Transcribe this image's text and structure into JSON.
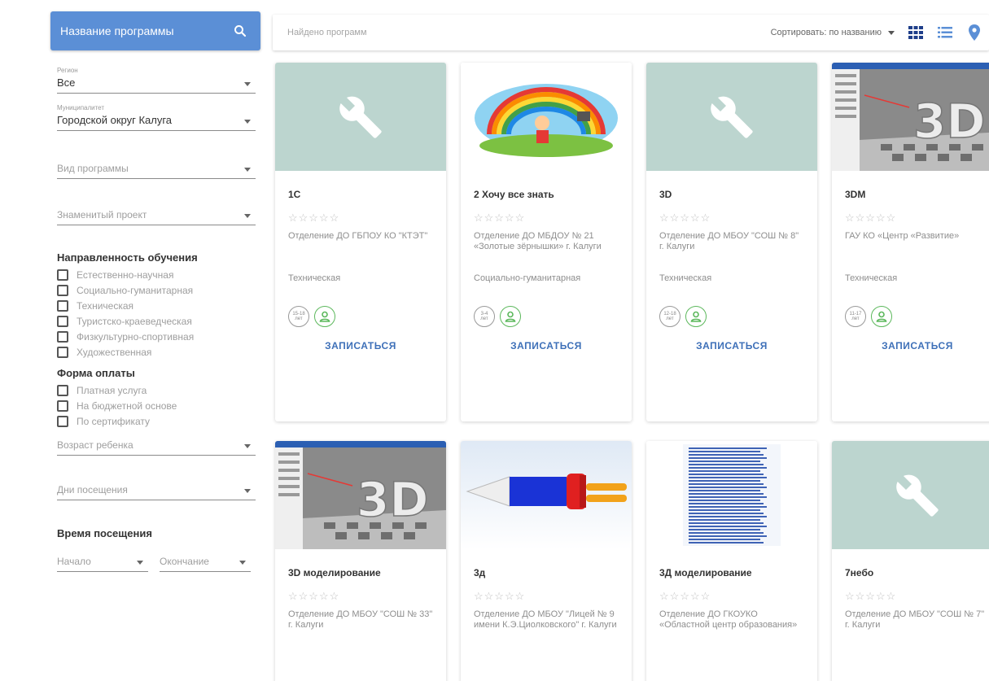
{
  "sidebar": {
    "program_name_label": "Название программы",
    "region": {
      "label": "Регион",
      "value": "Все"
    },
    "municipality": {
      "label": "Муниципалитет",
      "value": "Городской округ Калуга"
    },
    "program_type_placeholder": "Вид программы",
    "project_placeholder": "Знаменитый проект",
    "direction": {
      "title": "Направленность обучения",
      "options": [
        "Естественно-научная",
        "Социально-гуманитарная",
        "Техническая",
        "Туристско-краеведческая",
        "Физкультурно-спортивная",
        "Художественная"
      ]
    },
    "payment": {
      "title": "Форма оплаты",
      "options": [
        "Платная услуга",
        "На бюджетной основе",
        "По сертификату"
      ]
    },
    "child_age_placeholder": "Возраст ребенка",
    "visit_days_placeholder": "Дни посещения",
    "visit_time_title": "Время посещения",
    "start_placeholder": "Начало",
    "end_placeholder": "Окончание"
  },
  "topbar": {
    "search_placeholder": "Найдено программ",
    "sort_label": "Сортировать: по названию"
  },
  "colors": {
    "accent": "#5b8fd6",
    "link": "#3e70b8",
    "placeholder_bg": "#bcd5cf",
    "badge_green": "#5cb85c"
  },
  "cards": [
    {
      "title": "1С",
      "stars": "☆☆☆☆☆",
      "org": "Отделение ДО ГБПОУ КО \"КТЭТ\"",
      "direction": "Техническая",
      "age_top": "15-18",
      "age_bottom": "лет",
      "enroll": "ЗАПИСАТЬСЯ",
      "image": "placeholder"
    },
    {
      "title": "2 Хочу все знать",
      "stars": "☆☆☆☆☆",
      "org": "Отделение ДО МБДОУ № 21 «Золотые зёрнышки» г. Калуги",
      "direction": "Социально-гуманитарная",
      "age_top": "3-4",
      "age_bottom": "лет",
      "enroll": "ЗАПИСАТЬСЯ",
      "image": "rainbow"
    },
    {
      "title": "3D",
      "stars": "☆☆☆☆☆",
      "org": "Отделение ДО МБОУ \"СОШ № 8\" г. Калуги",
      "direction": "Техническая",
      "age_top": "12-18",
      "age_bottom": "лет",
      "enroll": "ЗАПИСАТЬСЯ",
      "image": "placeholder"
    },
    {
      "title": "3DM",
      "stars": "☆☆☆☆☆",
      "org": "ГАУ КО «Центр «Развитие»",
      "direction": "Техническая",
      "age_top": "11-17",
      "age_bottom": "лет",
      "enroll": "ЗАПИСАТЬСЯ",
      "image": "screenshot3d"
    },
    {
      "title": "3D моделирование",
      "stars": "☆☆☆☆☆",
      "org": "Отделение ДО МБОУ \"СОШ № 33\" г. Калуги",
      "image": "screenshot3d"
    },
    {
      "title": "3д",
      "stars": "☆☆☆☆☆",
      "org": "Отделение ДО МБОУ \"Лицей № 9 имени К.Э.Циолковского\" г. Калуги",
      "image": "rocket"
    },
    {
      "title": "3Д моделирование",
      "stars": "☆☆☆☆☆",
      "org": "Отделение ДО ГКОУКО «Областной центр образования»",
      "image": "document"
    },
    {
      "title": "7небо",
      "stars": "☆☆☆☆☆",
      "org": "Отделение ДО МБОУ \"СОШ № 7\" г. Калуги",
      "image": "placeholder"
    }
  ]
}
